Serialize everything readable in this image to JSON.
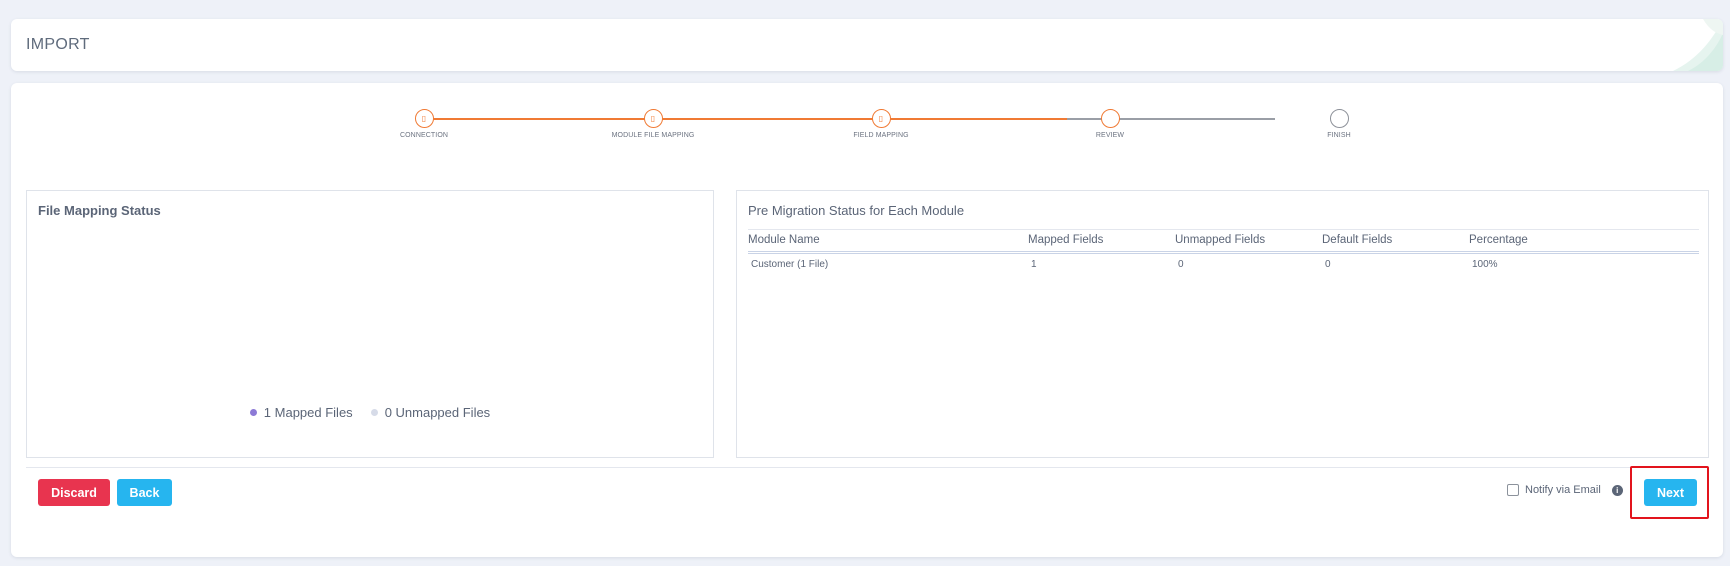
{
  "header": {
    "title": "IMPORT"
  },
  "stepper": {
    "steps": [
      {
        "label": "CONNECTION",
        "state": "done",
        "icon": "document-icon"
      },
      {
        "label": "MODULE FILE MAPPING",
        "state": "done",
        "icon": "document-icon"
      },
      {
        "label": "FIELD MAPPING",
        "state": "done",
        "icon": "document-icon"
      },
      {
        "label": "REVIEW",
        "state": "active",
        "icon": ""
      },
      {
        "label": "FINISH",
        "state": "pending",
        "icon": ""
      }
    ],
    "colors": {
      "done": "#f07a34",
      "pending": "#8d9199"
    }
  },
  "file_mapping": {
    "title": "File Mapping Status",
    "legend": [
      {
        "label": "1 Mapped Files",
        "color": "#8c7ad6"
      },
      {
        "label": "0 Unmapped Files",
        "color": "#d6dbe8"
      }
    ]
  },
  "pre_migration": {
    "title": "Pre Migration Status for Each Module",
    "columns": [
      "Module Name",
      "Mapped Fields",
      "Unmapped Fields",
      "Default Fields",
      "Percentage"
    ],
    "rows": [
      [
        "Customer (1 File)",
        "1",
        "0",
        "0",
        "100%"
      ]
    ]
  },
  "footer": {
    "discard_label": "Discard",
    "back_label": "Back",
    "notify_label": "Notify via Email",
    "notify_checked": false,
    "next_label": "Next"
  },
  "colors": {
    "accent": "#26b5ef",
    "danger": "#e8344f",
    "progress": "#f07a34",
    "highlight": "#e2141d"
  }
}
